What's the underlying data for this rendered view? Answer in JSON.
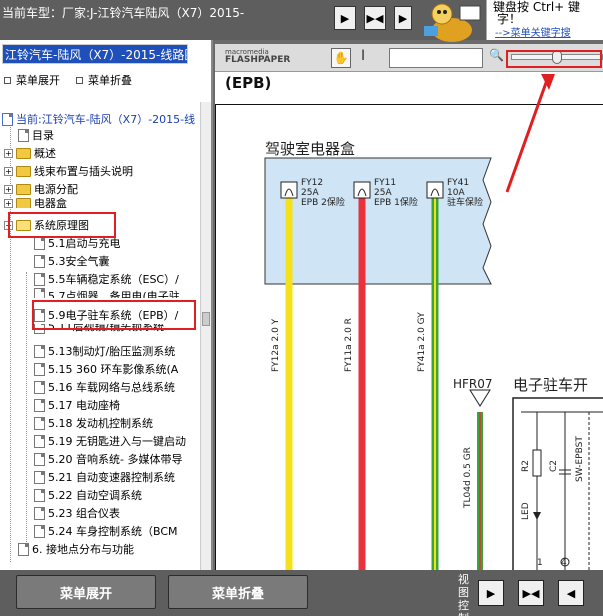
{
  "header": {
    "car_label": "当前车型：厂家:J-江铃汽车陆风（X7）2015-",
    "nav_prev": "▶",
    "nav_split": "▶◀",
    "nav_next": "▶",
    "promo_line1": "键盘按  Ctrl+  键",
    "promo_line2": "字！",
    "promo_link": "-->菜单关键字搜"
  },
  "tree_panel": {
    "title": "江铃汽车-陆风（X7）-2015-线路图",
    "expand_label": "菜单展开",
    "collapse_label": "菜单折叠",
    "root": "当前:江铃汽车-陆风（X7）-2015-线",
    "items": [
      {
        "label": "目录",
        "type": "doc"
      },
      {
        "label": "概述",
        "type": "folder"
      },
      {
        "label": "线束布置与插头说明",
        "type": "folder"
      },
      {
        "label": "电源分配",
        "type": "folder"
      },
      {
        "label": "电器盒",
        "type": "folder"
      },
      {
        "label": "系统原理图",
        "type": "folder-open"
      },
      {
        "label": "5.1启动与充电",
        "type": "doc"
      },
      {
        "label": "5.3安全气囊",
        "type": "doc"
      },
      {
        "label": "5.5车辆稳定系统（ESC）/",
        "type": "doc"
      },
      {
        "label": "5.7点烟器、备用电(电子驻",
        "type": "doc"
      },
      {
        "label": "5.9电子驻车系统（EPB）/",
        "type": "doc"
      },
      {
        "label": "5.11后视镜/镜头锁系统",
        "type": "doc"
      },
      {
        "label": "5.13制动灯/胎压监测系统",
        "type": "doc"
      },
      {
        "label": "5.15 360 环车影像系统(A",
        "type": "doc"
      },
      {
        "label": "5.16 车载网络与总线系统",
        "type": "doc"
      },
      {
        "label": "5.17 电动座椅",
        "type": "doc"
      },
      {
        "label": "5.18 发动机控制系统",
        "type": "doc"
      },
      {
        "label": "5.19 无钥匙进入与一键启动",
        "type": "doc"
      },
      {
        "label": "5.20 音响系统- 多媒体带导",
        "type": "doc"
      },
      {
        "label": "5.21 自动变速器控制系统",
        "type": "doc"
      },
      {
        "label": "5.22 自动空调系统",
        "type": "doc"
      },
      {
        "label": "5.23 组合仪表",
        "type": "doc"
      },
      {
        "label": "5.24 车身控制系统（BCM",
        "type": "doc"
      },
      {
        "label": "6. 接地点分布与功能",
        "type": "doc"
      }
    ]
  },
  "viewer": {
    "logo_top": "macromedia",
    "logo_bottom": "FLASHPAPER",
    "hand_icon": "hand-icon",
    "search_icon": "magnifier-icon",
    "zoom_level": 0.5
  },
  "document": {
    "title": "(EPB)",
    "cab_box_title": "驾驶室电器盒",
    "fuses": [
      {
        "id": "FY12",
        "amp": "25A",
        "desc": "EPB 2保险"
      },
      {
        "id": "FY11",
        "amp": "25A",
        "desc": "EPB 1保险"
      },
      {
        "id": "FY41",
        "amp": "10A",
        "desc": "驻车保险"
      }
    ],
    "wires": [
      {
        "label": "FY12a 2.0 Y",
        "color": "#f5e11a"
      },
      {
        "label": "FY11a 2.0 R",
        "color": "#e8323c"
      },
      {
        "label": "FY41a 2.0 GY",
        "color": "#3aa63a"
      },
      {
        "label": "TL04d 0.5 GR",
        "color": "#3aa63a"
      }
    ],
    "hfr_label": "HFR07",
    "ecu_title": "电子驻车开",
    "r2_label": "R2",
    "c2_label": "C2",
    "switch_label": "SW-EPBST",
    "led_label": "LED",
    "pin_1": "1",
    "pin_4": "4"
  },
  "footer": {
    "expand_button": "菜单展开",
    "collapse_button": "菜单折叠",
    "view_label": "视图控制"
  },
  "colors": {
    "annotation": "#e02020",
    "tree_title_bg": "#1f4fb8",
    "fuse_box_fill": "#cfe4f5"
  }
}
